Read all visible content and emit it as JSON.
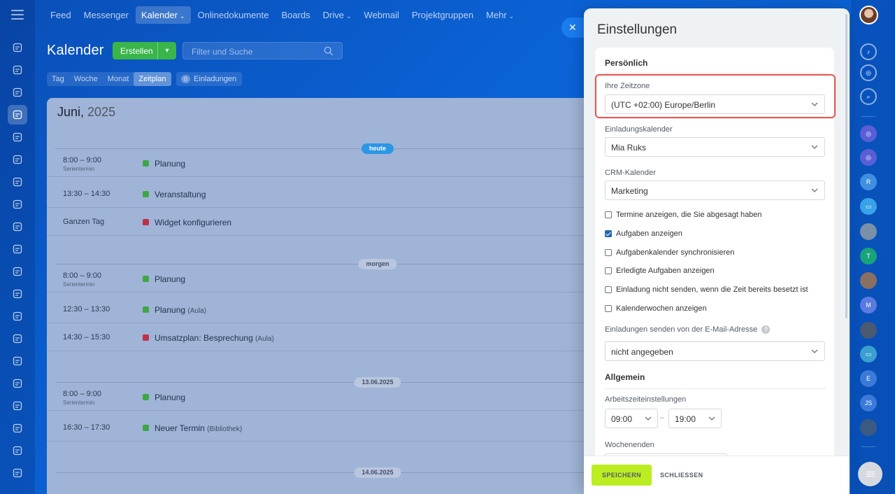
{
  "nav": {
    "items": [
      "Feed",
      "Messenger",
      "Kalender",
      "Onlinedokumente",
      "Boards",
      "Drive",
      "Webmail",
      "Projektgruppen",
      "Mehr"
    ]
  },
  "calendar": {
    "title": "Kalender",
    "create_label": "Erstellen",
    "search_placeholder": "Filter und Suche",
    "views": [
      "Tag",
      "Woche",
      "Monat",
      "Zeitplan"
    ],
    "invites_count": "0",
    "invites_label": "Einladungen",
    "month": "Juni,",
    "year": "2025",
    "days": [
      {
        "label": "heute",
        "events": [
          {
            "time": "8:00 – 9:00",
            "sub": "Serientermin",
            "name": "Planung",
            "loc": "",
            "color": "#3fa648"
          },
          {
            "time": "13:30 – 14:30",
            "sub": "",
            "name": "Veranstaltung",
            "loc": "",
            "color": "#3fa648"
          },
          {
            "time": "Ganzen Tag",
            "sub": "",
            "name": "Widget konfigurieren",
            "loc": "",
            "color": "#c0304a"
          }
        ]
      },
      {
        "label": "morgen",
        "events": [
          {
            "time": "8:00 – 9:00",
            "sub": "Serientermin",
            "name": "Planung",
            "loc": "",
            "color": "#3fa648"
          },
          {
            "time": "12:30 – 13:30",
            "sub": "",
            "name": "Planung",
            "loc": "(Aula)",
            "color": "#3fa648"
          },
          {
            "time": "14:30 – 15:30",
            "sub": "",
            "name": "Umsatzplan: Besprechung",
            "loc": "(Aula)",
            "color": "#c0304a"
          }
        ]
      },
      {
        "label": "13.06.2025",
        "events": [
          {
            "time": "8:00 – 9:00",
            "sub": "Serientermin",
            "name": "Planung",
            "loc": "",
            "color": "#3fa648"
          },
          {
            "time": "16:30 – 17:30",
            "sub": "",
            "name": "Neuer Termin",
            "loc": "(Bibliothek)",
            "color": "#3fa648"
          }
        ]
      },
      {
        "label": "14.06.2025",
        "events": []
      }
    ]
  },
  "settings": {
    "title": "Einstellungen",
    "personal_title": "Persönlich",
    "timezone_label": "Ihre Zeitzone",
    "timezone_value": "(UTC +02:00) Europe/Berlin",
    "invite_cal_label": "Einladungskalender",
    "invite_cal_value": "Mia Ruks",
    "crm_cal_label": "CRM-Kalender",
    "crm_cal_value": "Marketing",
    "checkboxes": [
      {
        "label": "Termine anzeigen, die Sie abgesagt haben",
        "checked": false
      },
      {
        "label": "Aufgaben anzeigen",
        "checked": true
      },
      {
        "label": "Aufgabenkalender synchronisieren",
        "checked": false
      },
      {
        "label": "Erledigte Aufgaben anzeigen",
        "checked": false
      },
      {
        "label": "Einladung nicht senden, wenn die Zeit bereits besetzt ist",
        "checked": false
      },
      {
        "label": "Kalenderwochen anzeigen",
        "checked": false
      }
    ],
    "email_label": "Einladungen senden von der E-Mail-Adresse",
    "email_value": "nicht angegeben",
    "general_title": "Allgemein",
    "worktime_label": "Arbeitszeiteinstellungen",
    "work_start": "09:00",
    "work_end": "19:00",
    "weekends_label": "Wochenenden",
    "save_label": "SPEICHERN",
    "close_label": "SCHLIESSEN"
  },
  "right_bar": {
    "initials": [
      "R",
      "T",
      "M",
      "E",
      "JS"
    ]
  }
}
